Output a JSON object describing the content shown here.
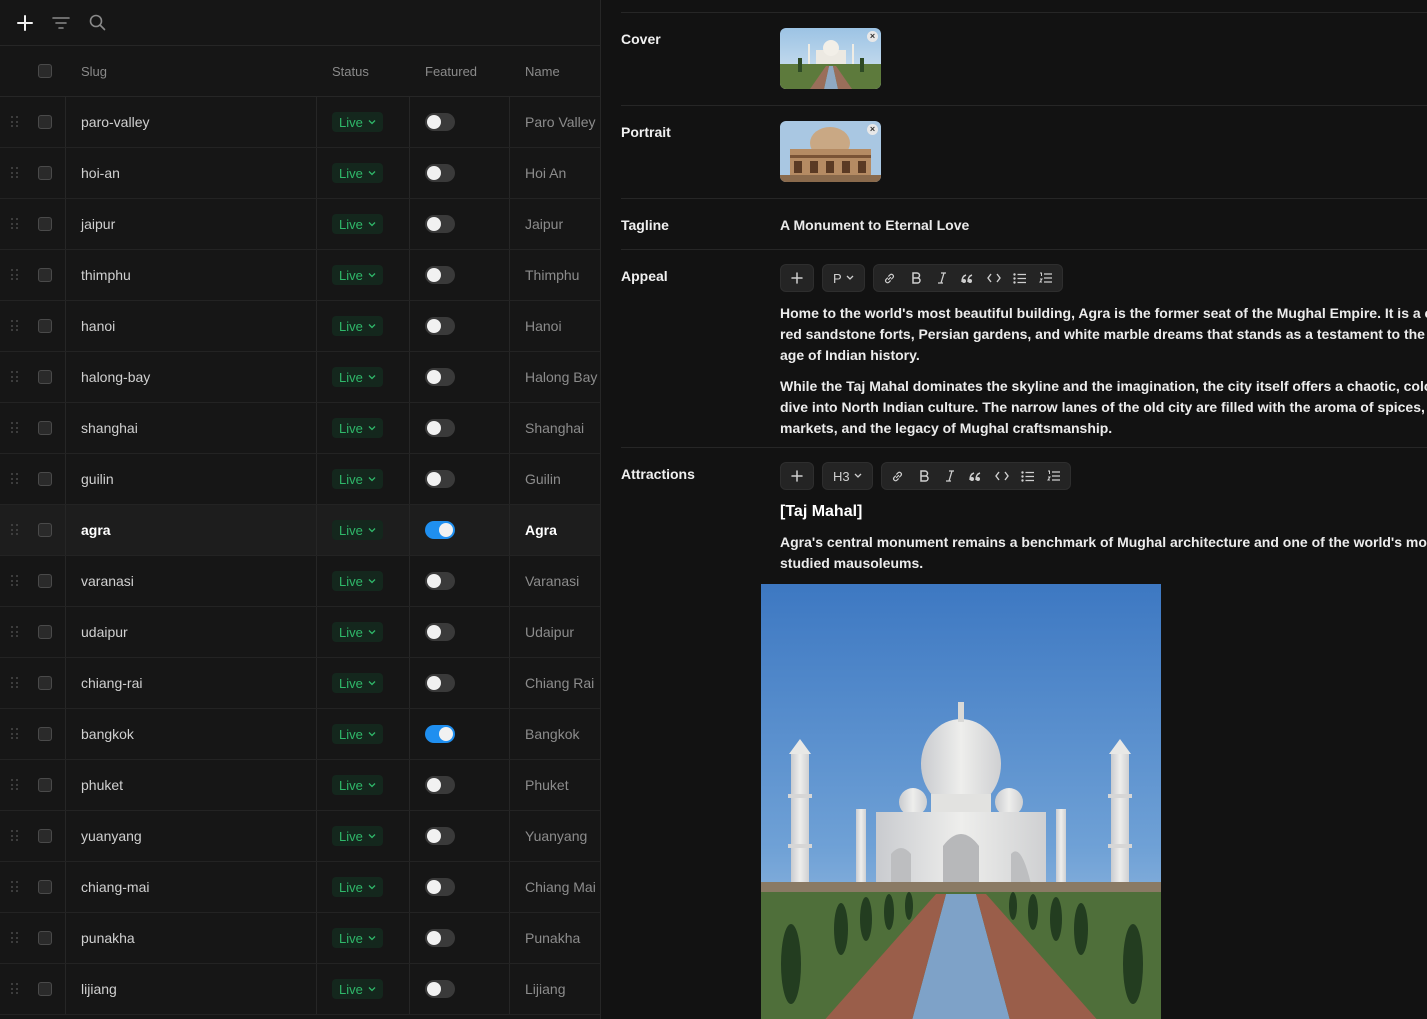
{
  "toolbar": {
    "add_icon": "plus-icon",
    "filter_icon": "filter-icon",
    "search_icon": "search-icon"
  },
  "table": {
    "columns": {
      "slug": "Slug",
      "status": "Status",
      "featured": "Featured",
      "name": "Name"
    },
    "rows": [
      {
        "slug": "paro-valley",
        "status": "Live",
        "featured": false,
        "name": "Paro Valley"
      },
      {
        "slug": "hoi-an",
        "status": "Live",
        "featured": false,
        "name": "Hoi An"
      },
      {
        "slug": "jaipur",
        "status": "Live",
        "featured": false,
        "name": "Jaipur"
      },
      {
        "slug": "thimphu",
        "status": "Live",
        "featured": false,
        "name": "Thimphu"
      },
      {
        "slug": "hanoi",
        "status": "Live",
        "featured": false,
        "name": "Hanoi"
      },
      {
        "slug": "halong-bay",
        "status": "Live",
        "featured": false,
        "name": "Halong Bay"
      },
      {
        "slug": "shanghai",
        "status": "Live",
        "featured": false,
        "name": "Shanghai"
      },
      {
        "slug": "guilin",
        "status": "Live",
        "featured": false,
        "name": "Guilin"
      },
      {
        "slug": "agra",
        "status": "Live",
        "featured": true,
        "name": "Agra",
        "selected": true
      },
      {
        "slug": "varanasi",
        "status": "Live",
        "featured": false,
        "name": "Varanasi"
      },
      {
        "slug": "udaipur",
        "status": "Live",
        "featured": false,
        "name": "Udaipur"
      },
      {
        "slug": "chiang-rai",
        "status": "Live",
        "featured": false,
        "name": "Chiang Rai"
      },
      {
        "slug": "bangkok",
        "status": "Live",
        "featured": true,
        "name": "Bangkok"
      },
      {
        "slug": "phuket",
        "status": "Live",
        "featured": false,
        "name": "Phuket"
      },
      {
        "slug": "yuanyang",
        "status": "Live",
        "featured": false,
        "name": "Yuanyang"
      },
      {
        "slug": "chiang-mai",
        "status": "Live",
        "featured": false,
        "name": "Chiang Mai"
      },
      {
        "slug": "punakha",
        "status": "Live",
        "featured": false,
        "name": "Punakha"
      },
      {
        "slug": "lijiang",
        "status": "Live",
        "featured": false,
        "name": "Lijiang"
      }
    ]
  },
  "detail": {
    "cover_label": "Cover",
    "portrait_label": "Portrait",
    "tagline_label": "Tagline",
    "tagline_value": "A Monument to Eternal Love",
    "appeal_label": "Appeal",
    "appeal_block_type": "P",
    "appeal_paragraphs": [
      [
        "Home to the world's most beautiful building, Agra is the former seat of the Mughal Empire. It is a city of",
        "red sandstone forts, Persian gardens, and white marble dreams that stands as a testament to the golden",
        "age of Indian history."
      ],
      [
        "While the Taj Mahal dominates the skyline and the imagination, the city itself offers a chaotic, colorful",
        "dive into North Indian culture. The narrow lanes of the old city are filled with the aroma of spices, leather",
        "markets, and the legacy of Mughal craftsmanship."
      ]
    ],
    "attractions_label": "Attractions",
    "attractions_block_type": "H3",
    "attractions_heading": "[Taj Mahal]",
    "attractions_text": [
      "Agra's central monument remains a benchmark of Mughal architecture and one of the world's most",
      "studied mausoleums."
    ],
    "remove_glyph": "×"
  },
  "colors": {
    "live_text": "#2fb86a",
    "toggle_on": "#1f8ff0",
    "background": "#121212"
  }
}
